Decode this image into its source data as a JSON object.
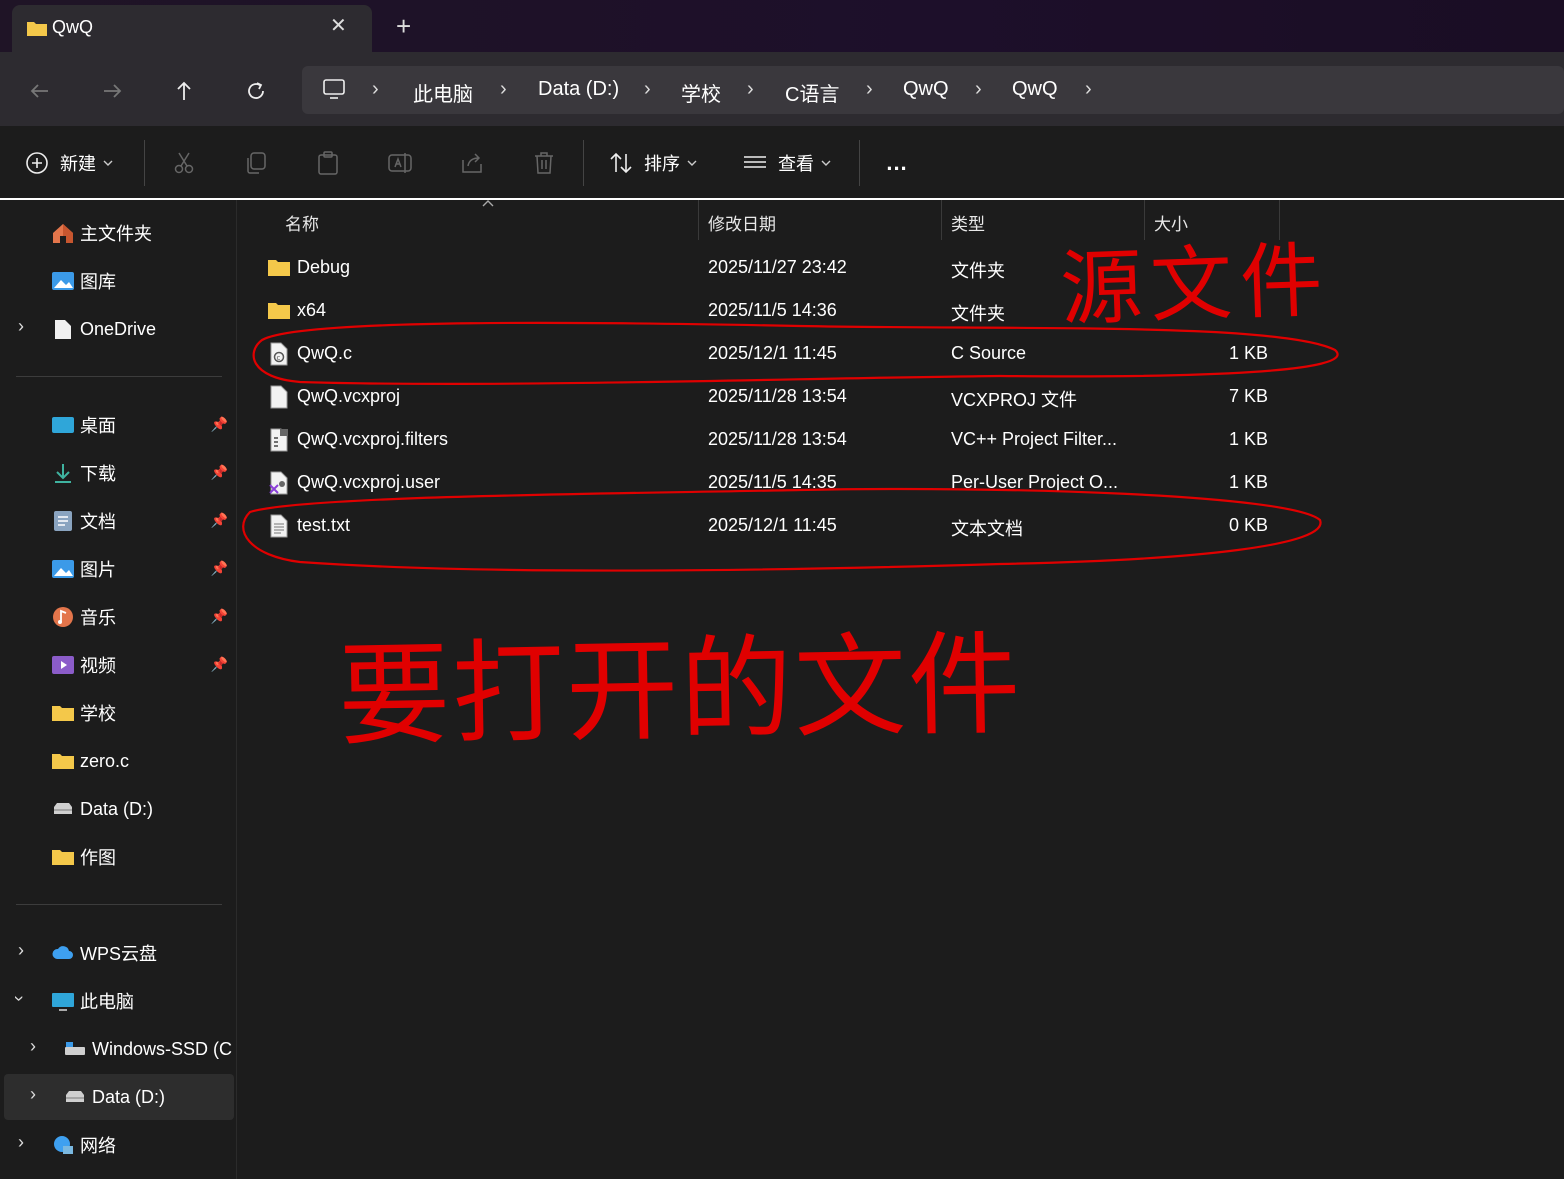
{
  "tab": {
    "title": "QwQ",
    "close": "✕",
    "new": "+"
  },
  "breadcrumb": [
    "此电脑",
    "Data (D:)",
    "学校",
    "C语言",
    "QwQ",
    "QwQ"
  ],
  "toolbar": {
    "new_label": "新建",
    "sort_label": "排序",
    "view_label": "查看",
    "more": "..."
  },
  "sidebar": {
    "quick": [
      {
        "label": "主文件夹",
        "icon": "home-icon"
      },
      {
        "label": "图库",
        "icon": "gallery-icon"
      },
      {
        "label": "OneDrive",
        "icon": "onedrive-icon"
      }
    ],
    "pinned": [
      {
        "label": "桌面",
        "icon": "desktop-icon"
      },
      {
        "label": "下载",
        "icon": "download-icon"
      },
      {
        "label": "文档",
        "icon": "documents-icon"
      },
      {
        "label": "图片",
        "icon": "pictures-icon"
      },
      {
        "label": "音乐",
        "icon": "music-icon"
      },
      {
        "label": "视频",
        "icon": "videos-icon"
      },
      {
        "label": "学校",
        "icon": "folder-icon"
      },
      {
        "label": "zero.c",
        "icon": "folder-icon"
      },
      {
        "label": "Data (D:)",
        "icon": "drive-icon"
      },
      {
        "label": "作图",
        "icon": "folder-icon"
      }
    ],
    "tree": [
      {
        "label": "WPS云盘",
        "icon": "cloud-icon"
      },
      {
        "label": "此电脑",
        "icon": "pc-icon"
      },
      {
        "label": "Windows-SSD (C",
        "icon": "ssd-icon"
      },
      {
        "label": "Data (D:)",
        "icon": "drive-icon"
      },
      {
        "label": "网络",
        "icon": "network-icon"
      }
    ]
  },
  "columns": {
    "name": "名称",
    "date": "修改日期",
    "type": "类型",
    "size": "大小"
  },
  "files": [
    {
      "name": "Debug",
      "date": "2025/11/27 23:42",
      "type": "文件夹",
      "size": "",
      "icon": "folder-icon"
    },
    {
      "name": "x64",
      "date": "2025/11/5 14:36",
      "type": "文件夹",
      "size": "",
      "icon": "folder-icon"
    },
    {
      "name": "QwQ.c",
      "date": "2025/12/1 11:45",
      "type": "C Source",
      "size": "1 KB",
      "icon": "c-file-icon"
    },
    {
      "name": "QwQ.vcxproj",
      "date": "2025/11/28 13:54",
      "type": "VCXPROJ 文件",
      "size": "7 KB",
      "icon": "file-icon"
    },
    {
      "name": "QwQ.vcxproj.filters",
      "date": "2025/11/28 13:54",
      "type": "VC++ Project Filter...",
      "size": "1 KB",
      "icon": "filters-file-icon"
    },
    {
      "name": "QwQ.vcxproj.user",
      "date": "2025/11/5 14:35",
      "type": "Per-User Project O...",
      "size": "1 KB",
      "icon": "vs-user-file-icon"
    },
    {
      "name": "test.txt",
      "date": "2025/12/1 11:45",
      "type": "文本文档",
      "size": "0 KB",
      "icon": "text-file-icon"
    }
  ],
  "annotations": {
    "top": "源文件",
    "bottom": "要打开的文件"
  },
  "colors": {
    "ink": "#e00000",
    "folder": "#f4c84a",
    "bg": "#1c1c1c"
  }
}
